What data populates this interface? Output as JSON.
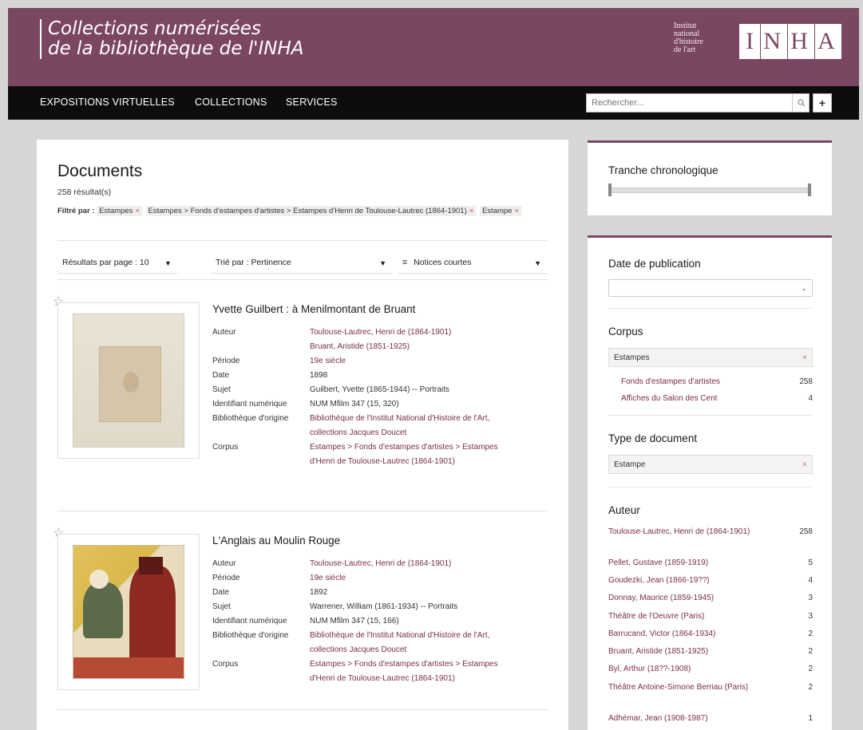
{
  "header": {
    "title_line1": "Collections numérisées",
    "title_line2": "de la bibliothèque de l'INHA",
    "inst_lines": [
      "Institut",
      "national",
      "d'histoire",
      "de l'art"
    ],
    "logo_letters": [
      "I",
      "N",
      "H",
      "A"
    ]
  },
  "nav": {
    "items": [
      "EXPOSITIONS VIRTUELLES",
      "COLLECTIONS",
      "SERVICES"
    ],
    "search_placeholder": "Rechercher...",
    "plus_label": "+",
    "search_icon": "search-icon"
  },
  "main": {
    "title": "Documents",
    "result_count": "258 résultat(s)",
    "filter_label": "Filtré par :",
    "filters": [
      "Estampes",
      "Estampes > Fonds d'estampes d'artistes > Estampes d'Henri de Toulouse-Lautrec (1864-1901)",
      "Estampe"
    ],
    "controls": {
      "per_page": "Résultats par page : 10",
      "sort": "Trié par : Pertinence",
      "view": "Notices courtes"
    },
    "records": [
      {
        "title": "Yvette Guilbert : à Menilmontant de Bruant",
        "rows": [
          {
            "label": "Auteur",
            "values": [
              "Toulouse-Lautrec, Henri de (1864-1901)",
              "Bruant, Aristide (1851-1925)"
            ],
            "link": true
          },
          {
            "label": "Période",
            "values": [
              "19e siècle"
            ],
            "link": true
          },
          {
            "label": "Date",
            "values": [
              "1898"
            ],
            "link": false
          },
          {
            "label": "Sujet",
            "values": [
              "Guilbert, Yvette (1865-1944) -- Portraits"
            ],
            "link": false
          },
          {
            "label": "Identifiant numérique",
            "values": [
              "NUM Mfilm 347 (15, 320)"
            ],
            "link": false
          },
          {
            "label": "Bibliothèque d'origine",
            "values": [
              "Bibliothèque de l'Institut National d'Histoire de l'Art,",
              "collections Jacques Doucet"
            ],
            "link": true
          },
          {
            "label": "Corpus",
            "values": [
              "Estampes > Fonds d'estampes d'artistes > Estampes",
              "d'Henri de Toulouse-Lautrec (1864-1901)"
            ],
            "link": true
          }
        ]
      },
      {
        "title": "L'Anglais au Moulin Rouge",
        "rows": [
          {
            "label": "Auteur",
            "values": [
              "Toulouse-Lautrec, Henri de (1864-1901)"
            ],
            "link": true
          },
          {
            "label": "Période",
            "values": [
              "19e siècle"
            ],
            "link": true
          },
          {
            "label": "Date",
            "values": [
              "1892"
            ],
            "link": false
          },
          {
            "label": "Sujet",
            "values": [
              "Warrener, William (1861-1934) -- Portraits"
            ],
            "link": false
          },
          {
            "label": "Identifiant numérique",
            "values": [
              "NUM Mfilm 347 (15, 166)"
            ],
            "link": false
          },
          {
            "label": "Bibliothèque d'origine",
            "values": [
              "Bibliothèque de l'Institut National d'Histoire de l'Art,",
              "collections Jacques Doucet"
            ],
            "link": true
          },
          {
            "label": "Corpus",
            "values": [
              "Estampes > Fonds d'estampes d'artistes > Estampes",
              "d'Henri de Toulouse-Lautrec (1864-1901)"
            ],
            "link": true
          }
        ]
      }
    ]
  },
  "sidebar": {
    "chrono_title": "Tranche chronologique",
    "pub_title": "Date de publication",
    "corpus_title": "Corpus",
    "corpus_selected": "Estampes",
    "corpus_items": [
      {
        "label": "Fonds d'estampes d'artistes",
        "count": "258"
      },
      {
        "label": "Affiches du Salon des Cent",
        "count": "4"
      }
    ],
    "type_title": "Type de document",
    "type_selected": "Estampe",
    "author_title": "Auteur",
    "authors": [
      {
        "label": "Toulouse-Lautrec, Henri de (1864-1901)",
        "count": "258"
      },
      {
        "label": "Pellet, Gustave (1859-1919)",
        "count": "5"
      },
      {
        "label": "Goudezki, Jean (1866-19??)",
        "count": "4"
      },
      {
        "label": "Donnay, Maurice (1859-1945)",
        "count": "3"
      },
      {
        "label": "Théâtre de l'Oeuvre (Paris)",
        "count": "3"
      },
      {
        "label": "Barrucand, Victor (1864-1934)",
        "count": "2"
      },
      {
        "label": "Bruant, Aristide (1851-1925)",
        "count": "2"
      },
      {
        "label": "Byl, Arthur (18??-1908)",
        "count": "2"
      },
      {
        "label": "Théâtre Antoine-Simone Berriau (Paris)",
        "count": "2"
      },
      {
        "label": "Adhémar, Jean (1908-1987)",
        "count": "1"
      }
    ]
  }
}
